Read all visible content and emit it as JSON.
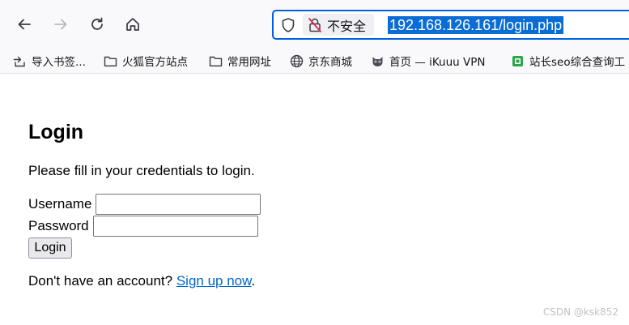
{
  "browser": {
    "security_label": "不安全",
    "url": "192.168.126.161/login.php",
    "icons": {
      "back": "arrow-left-icon",
      "forward": "arrow-right-icon",
      "reload": "reload-icon",
      "home": "home-icon",
      "shield": "shield-icon",
      "insecure": "lock-crossed-icon"
    }
  },
  "bookmarks": [
    {
      "label": "导入书签...",
      "icon": "import-icon"
    },
    {
      "label": "火狐官方站点",
      "icon": "folder-icon"
    },
    {
      "label": "常用网址",
      "icon": "folder-icon"
    },
    {
      "label": "京东商城",
      "icon": "globe-icon"
    },
    {
      "label": "首页 — iKuuu VPN",
      "icon": "cat-icon"
    },
    {
      "label": "站长seo综合查询工",
      "icon": "seo-icon"
    }
  ],
  "page": {
    "title": "Login",
    "description": "Please fill in your credentials to login.",
    "username_label": "Username",
    "username_value": "",
    "password_label": "Password",
    "password_value": "",
    "login_button": "Login",
    "signup_prefix": "Don't have an account?",
    "signup_link": "Sign up now",
    "signup_suffix": "."
  },
  "watermark": "CSDN @ksk852",
  "colors": {
    "url_highlight": "#0a6cd5",
    "focus_border": "#0061e0",
    "link": "#0066cc"
  }
}
